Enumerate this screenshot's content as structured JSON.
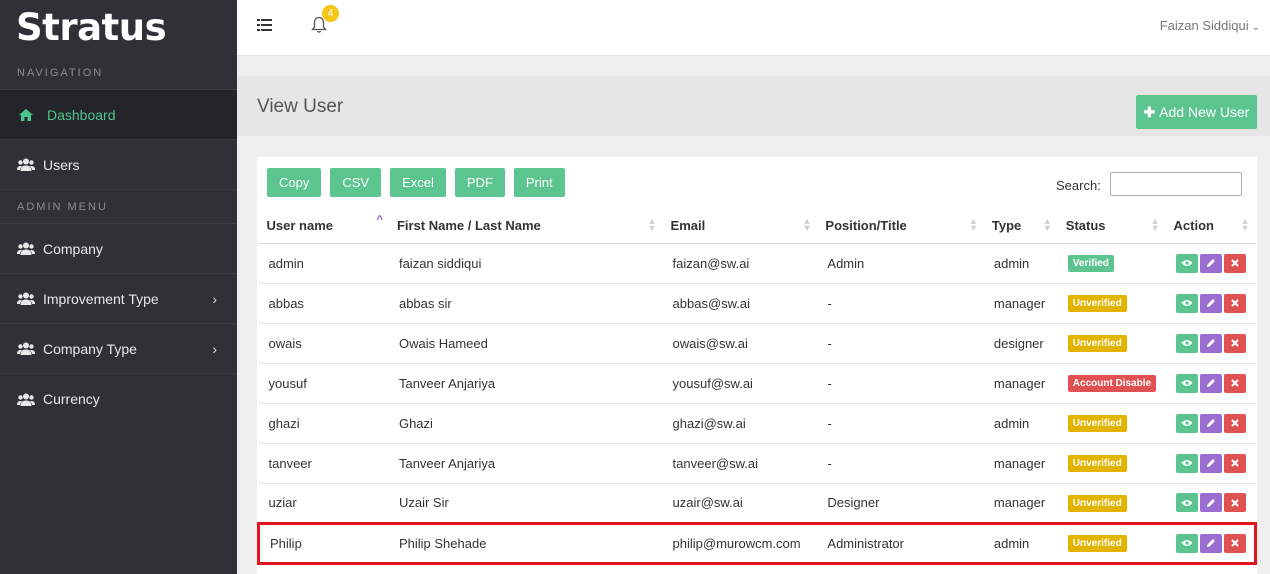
{
  "sidebar": {
    "brand": "Stratus",
    "section_nav": "NAVIGATION",
    "section_admin": "ADMIN MENU",
    "items": [
      {
        "label": "Dashboard"
      },
      {
        "label": "Users"
      },
      {
        "label": "Company"
      },
      {
        "label": "Improvement Type"
      },
      {
        "label": "Company Type"
      },
      {
        "label": "Currency"
      }
    ]
  },
  "topbar": {
    "notification_count": "4",
    "user_name": "Faizan Siddiqui"
  },
  "header": {
    "title": "View User",
    "add_button": "Add New User"
  },
  "toolbar": {
    "buttons": [
      "Copy",
      "CSV",
      "Excel",
      "PDF",
      "Print"
    ],
    "search_label": "Search:",
    "search_value": ""
  },
  "table": {
    "columns": [
      "User name",
      "First Name / Last Name",
      "Email",
      "Position/Title",
      "Type",
      "Status",
      "Action"
    ],
    "rows": [
      {
        "username": "admin",
        "name": "faizan siddiqui",
        "email": "faizan@sw.ai",
        "position": "Admin",
        "type": "admin",
        "status": "Verified"
      },
      {
        "username": "abbas",
        "name": "abbas sir",
        "email": "abbas@sw.ai",
        "position": "-",
        "type": "manager",
        "status": "Unverified"
      },
      {
        "username": "owais",
        "name": "Owais Hameed",
        "email": "owais@sw.ai",
        "position": "-",
        "type": "designer",
        "status": "Unverified"
      },
      {
        "username": "yousuf",
        "name": "Tanveer Anjariya",
        "email": "yousuf@sw.ai",
        "position": "-",
        "type": "manager",
        "status": "Account Disable"
      },
      {
        "username": "ghazi",
        "name": "Ghazi",
        "email": "ghazi@sw.ai",
        "position": "-",
        "type": "admin",
        "status": "Unverified"
      },
      {
        "username": "tanveer",
        "name": "Tanveer Anjariya",
        "email": "tanveer@sw.ai",
        "position": "-",
        "type": "manager",
        "status": "Unverified"
      },
      {
        "username": "uziar",
        "name": "Uzair Sir",
        "email": "uzair@sw.ai",
        "position": "Designer",
        "type": "manager",
        "status": "Unverified"
      },
      {
        "username": "Philip",
        "name": "Philip Shehade",
        "email": "philip@murowcm.com",
        "position": "Administrator",
        "type": "admin",
        "status": "Unverified"
      }
    ]
  },
  "colors": {
    "accent_green": "#5cc58f",
    "verified": "#5cc58f",
    "unverified": "#e2b400",
    "account_disable": "#e05252",
    "highlight_border": "#e0161c"
  },
  "icons": {
    "dashboard": "home-icon",
    "users": "users-icon",
    "menu": "menu-toggle-icon",
    "bell": "bell-icon",
    "view": "eye-icon",
    "edit": "pencil-icon",
    "delete": "close-icon"
  }
}
